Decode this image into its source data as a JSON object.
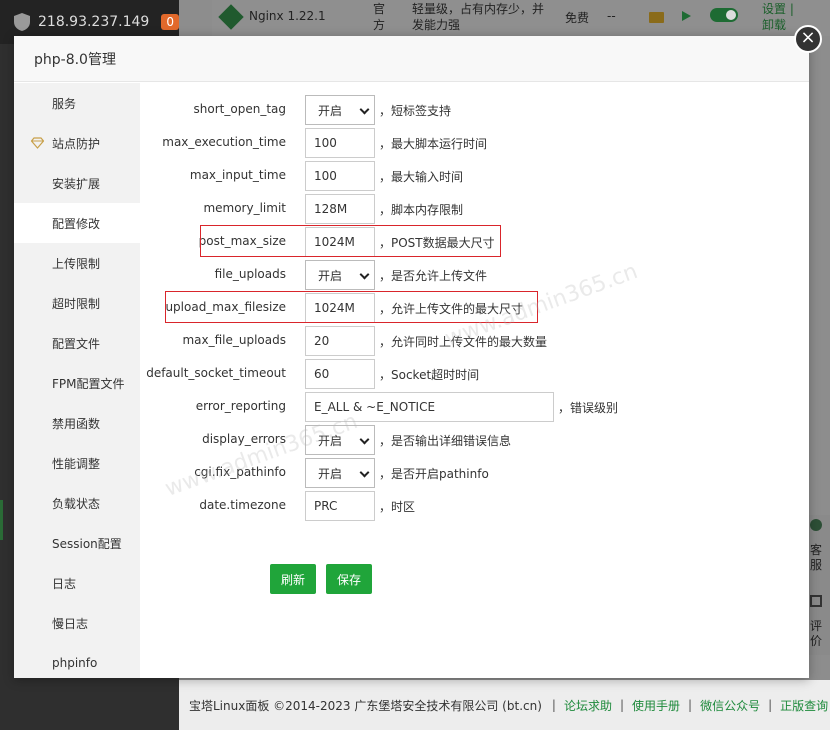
{
  "background": {
    "server_ip": "218.93.237.149",
    "alert_count": "0",
    "software_row": {
      "name": "Nginx 1.22.1",
      "source": "官方",
      "description": "轻量级，占有内存少，并发能力强",
      "price": "免费",
      "expire": "--",
      "actions": "设置 | 卸载"
    },
    "side_widget": {
      "customer_service": "客服",
      "review": "评价"
    },
    "footer": {
      "copyright": "宝塔Linux面板 ©2014-2023 广东堡塔安全技术有限公司 (bt.cn)",
      "links": [
        "论坛求助",
        "使用手册",
        "微信公众号",
        "正版查询"
      ]
    }
  },
  "modal": {
    "title": "php-8.0管理",
    "close_symbol": "×",
    "watermark": "www.admin365.cn",
    "sidebar": [
      "服务",
      "站点防护",
      "安装扩展",
      "配置修改",
      "上传限制",
      "超时限制",
      "配置文件",
      "FPM配置文件",
      "禁用函数",
      "性能调整",
      "负载状态",
      "Session配置",
      "日志",
      "慢日志",
      "phpinfo"
    ],
    "active_item": "配置修改",
    "settings": [
      {
        "key": "short_open_tag",
        "type": "select",
        "value": "开启",
        "hint": "，短标签支持"
      },
      {
        "key": "max_execution_time",
        "type": "input",
        "value": "100",
        "hint": "，最大脚本运行时间"
      },
      {
        "key": "max_input_time",
        "type": "input",
        "value": "100",
        "hint": "，最大输入时间"
      },
      {
        "key": "memory_limit",
        "type": "input",
        "value": "128M",
        "hint": "，脚本内存限制"
      },
      {
        "key": "post_max_size",
        "type": "input",
        "value": "1024M",
        "hint": "，POST数据最大尺寸"
      },
      {
        "key": "file_uploads",
        "type": "select",
        "value": "开启",
        "hint": "，是否允许上传文件"
      },
      {
        "key": "upload_max_filesize",
        "type": "input",
        "value": "1024M",
        "hint": "，允许上传文件的最大尺寸"
      },
      {
        "key": "max_file_uploads",
        "type": "input",
        "value": "20",
        "hint": "，允许同时上传文件的最大数量"
      },
      {
        "key": "default_socket_timeout",
        "type": "input",
        "value": "60",
        "hint": "，Socket超时时间"
      },
      {
        "key": "error_reporting",
        "type": "input-wide",
        "value": "E_ALL & ~E_NOTICE",
        "hint": "，错误级别"
      },
      {
        "key": "display_errors",
        "type": "select",
        "value": "开启",
        "hint": "，是否输出详细错误信息"
      },
      {
        "key": "cgi.fix_pathinfo",
        "type": "select",
        "value": "开启",
        "hint": "，是否开启pathinfo"
      },
      {
        "key": "date.timezone",
        "type": "input",
        "value": "PRC",
        "hint": "，时区"
      }
    ],
    "buttons": {
      "refresh": "刷新",
      "save": "保存"
    },
    "colors": {
      "accent": "#20a53a",
      "highlight": "#d9252b"
    }
  }
}
